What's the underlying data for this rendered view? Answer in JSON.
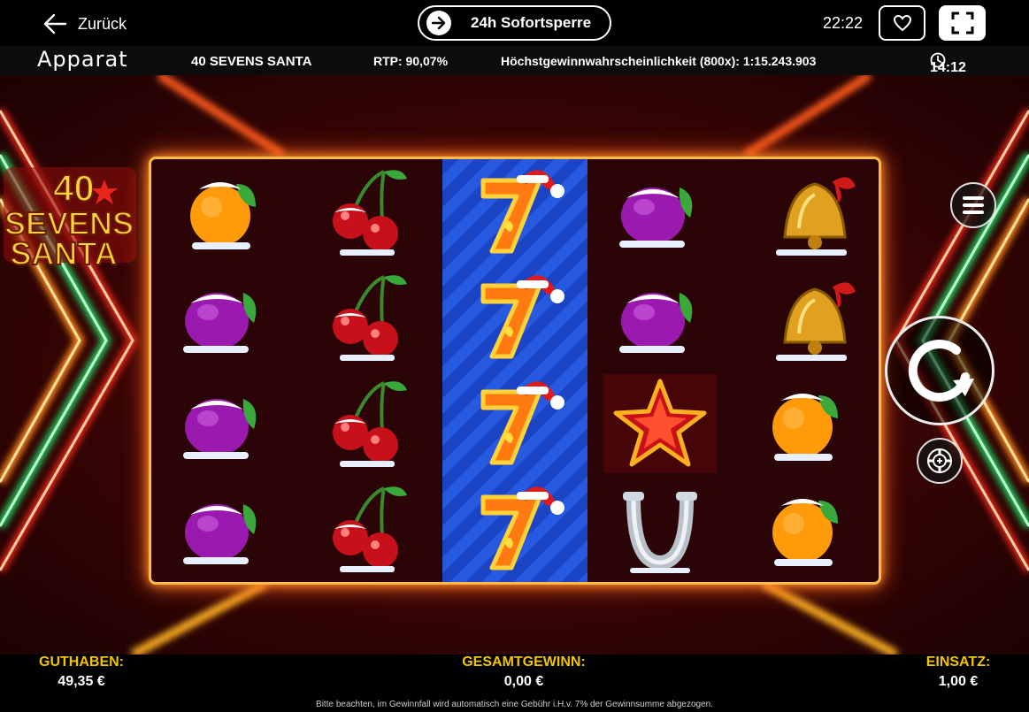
{
  "topbar": {
    "back_label": "Zurück",
    "block_label": "24h Sofortsperre",
    "time": "22:22"
  },
  "infobar": {
    "brand": "Apparat",
    "game_name": "40 SEVENS SANTA",
    "rtp": "RTP: 90,07%",
    "max_win_probability": "Höchstgewinnwahrscheinlichkeit (800x): 1:15.243.903",
    "session_timer": "14:12"
  },
  "logo": {
    "line1": "40",
    "line2": "SEVENS",
    "line3": "SANTA"
  },
  "reels": [
    [
      "orange",
      "plum",
      "plum",
      "plum"
    ],
    [
      "cherry",
      "cherry",
      "cherry",
      "cherry"
    ],
    [
      "seven",
      "seven",
      "seven",
      "seven"
    ],
    [
      "plum",
      "plum",
      "star",
      "horseshoe"
    ],
    [
      "bell",
      "bell",
      "orange",
      "orange"
    ]
  ],
  "bottom": {
    "balance_label": "GUTHABEN:",
    "balance_value": "49,35 €",
    "total_win_label": "GESAMTGEWINN:",
    "total_win_value": "0,00 €",
    "bet_label": "EINSATZ:",
    "bet_value": "1,00 €",
    "disclaimer": "Bitte beachten, im Gewinnfall wird automatisch eine Gebühr i.H.v. 7% der Gewinnsumme abgezogen."
  },
  "colors": {
    "accent_yellow": "#f5c400",
    "reel_frame": "#ffb84a",
    "wild_reel": "#2658e0"
  },
  "icons": [
    "arrow-left-icon",
    "arrow-right-icon",
    "heart-icon",
    "fullscreen-icon",
    "clock-icon",
    "menu-icon",
    "spin-icon",
    "bet-chip-icon"
  ]
}
